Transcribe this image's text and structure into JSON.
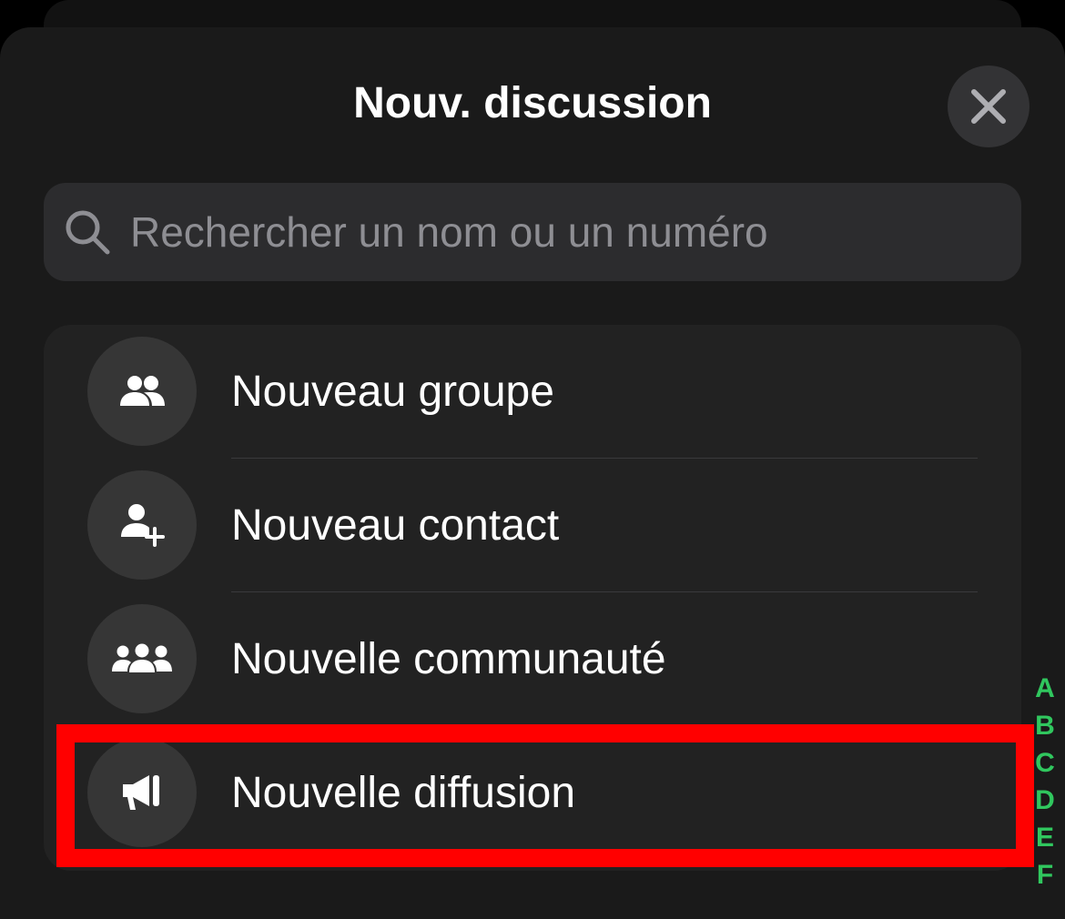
{
  "header": {
    "title": "Nouv. discussion",
    "close_icon": "close-icon"
  },
  "search": {
    "placeholder": "Rechercher un nom ou un numéro",
    "value": "",
    "icon": "search-icon"
  },
  "menu": {
    "items": [
      {
        "label": "Nouveau groupe",
        "icon": "group-icon"
      },
      {
        "label": "Nouveau contact",
        "icon": "add-contact-icon"
      },
      {
        "label": "Nouvelle communauté",
        "icon": "community-icon"
      },
      {
        "label": "Nouvelle diffusion",
        "icon": "megaphone-icon",
        "highlighted": true
      }
    ]
  },
  "index": {
    "letters": [
      "A",
      "B",
      "C",
      "D",
      "E",
      "F"
    ]
  },
  "colors": {
    "background": "#000000",
    "sheet": "#1a1a1a",
    "list": "#222222",
    "search_field": "#2c2c2e",
    "placeholder": "#8e8e93",
    "index_accent": "#30c75e",
    "highlight": "#ff0000"
  }
}
